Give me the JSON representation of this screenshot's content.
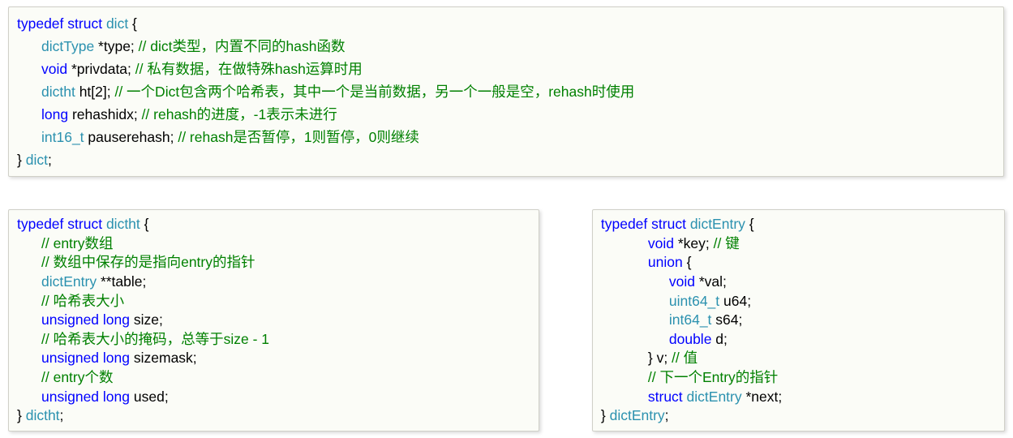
{
  "box1": {
    "l1": {
      "a": "typedef",
      "b": "struct",
      "c": "dict",
      "d": " {"
    },
    "l2": {
      "a": "dictType",
      "b": " *type; ",
      "c": "// dict类型，内置不同的hash函数"
    },
    "l3": {
      "a": "void",
      "b": " *privdata;     ",
      "c": "// 私有数据，在做特殊hash运算时用"
    },
    "l4": {
      "a": "dictht",
      "b": " ht[2]; ",
      "c": "// 一个Dict包含两个哈希表，其中一个是当前数据，另一个一般是空，rehash时使用"
    },
    "l5": {
      "a": "long",
      "b": " rehashidx;   ",
      "c": "// rehash的进度，-1表示未进行"
    },
    "l6": {
      "a": "int16_t",
      "b": " pauserehash; ",
      "c": "// rehash是否暂停，1则暂停，0则继续"
    },
    "l7": {
      "a": "} ",
      "b": "dict",
      "c": ";"
    }
  },
  "box2": {
    "l1": {
      "a": "typedef",
      "b": "struct",
      "c": "dictht",
      "d": " {"
    },
    "l2": "// entry数组",
    "l3": "// 数组中保存的是指向entry的指针",
    "l4": {
      "a": "dictEntry",
      "b": " **table;"
    },
    "l5": "// 哈希表大小",
    "l6": {
      "a": "unsigned",
      "b": "long",
      "c": " size;"
    },
    "l7": "// 哈希表大小的掩码，总等于size - 1",
    "l8": {
      "a": "unsigned",
      "b": "long",
      "c": " sizemask;"
    },
    "l9": "// entry个数",
    "l10": {
      "a": "unsigned",
      "b": "long",
      "c": " used;"
    },
    "l11": {
      "a": "} ",
      "b": "dictht",
      "c": ";"
    }
  },
  "box3": {
    "l1": {
      "a": "typedef",
      "b": "struct",
      "c": "dictEntry",
      "d": " {"
    },
    "l2": {
      "a": "void",
      "b": " *key; ",
      "c": "// 键"
    },
    "l3": {
      "a": "union",
      "b": " {"
    },
    "l4": {
      "a": "void",
      "b": " *val;"
    },
    "l5": {
      "a": "uint64_t",
      "b": " u64;"
    },
    "l6": {
      "a": "int64_t",
      "b": " s64;"
    },
    "l7": {
      "a": "double",
      "b": " d;"
    },
    "l8": {
      "a": "} v; ",
      "b": "// 值"
    },
    "l9": "// 下一个Entry的指针",
    "l10": {
      "a": "struct",
      "b": "dictEntry",
      "c": " *next;"
    },
    "l11": {
      "a": "} ",
      "b": "dictEntry",
      "c": ";"
    }
  }
}
